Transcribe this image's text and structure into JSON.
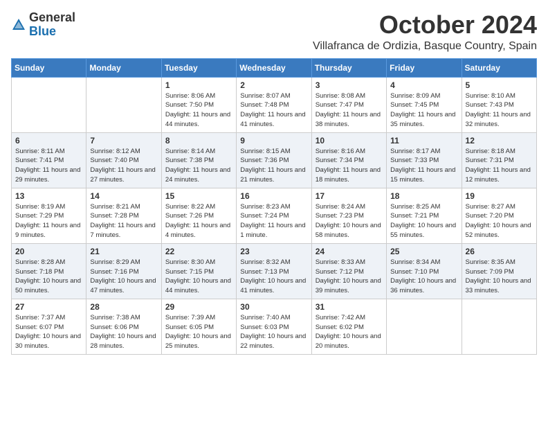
{
  "logo": {
    "general": "General",
    "blue": "Blue"
  },
  "title": "October 2024",
  "location": "Villafranca de Ordizia, Basque Country, Spain",
  "days_of_week": [
    "Sunday",
    "Monday",
    "Tuesday",
    "Wednesday",
    "Thursday",
    "Friday",
    "Saturday"
  ],
  "weeks": [
    [
      {
        "day": "",
        "info": ""
      },
      {
        "day": "",
        "info": ""
      },
      {
        "day": "1",
        "info": "Sunrise: 8:06 AM\nSunset: 7:50 PM\nDaylight: 11 hours and 44 minutes."
      },
      {
        "day": "2",
        "info": "Sunrise: 8:07 AM\nSunset: 7:48 PM\nDaylight: 11 hours and 41 minutes."
      },
      {
        "day": "3",
        "info": "Sunrise: 8:08 AM\nSunset: 7:47 PM\nDaylight: 11 hours and 38 minutes."
      },
      {
        "day": "4",
        "info": "Sunrise: 8:09 AM\nSunset: 7:45 PM\nDaylight: 11 hours and 35 minutes."
      },
      {
        "day": "5",
        "info": "Sunrise: 8:10 AM\nSunset: 7:43 PM\nDaylight: 11 hours and 32 minutes."
      }
    ],
    [
      {
        "day": "6",
        "info": "Sunrise: 8:11 AM\nSunset: 7:41 PM\nDaylight: 11 hours and 29 minutes."
      },
      {
        "day": "7",
        "info": "Sunrise: 8:12 AM\nSunset: 7:40 PM\nDaylight: 11 hours and 27 minutes."
      },
      {
        "day": "8",
        "info": "Sunrise: 8:14 AM\nSunset: 7:38 PM\nDaylight: 11 hours and 24 minutes."
      },
      {
        "day": "9",
        "info": "Sunrise: 8:15 AM\nSunset: 7:36 PM\nDaylight: 11 hours and 21 minutes."
      },
      {
        "day": "10",
        "info": "Sunrise: 8:16 AM\nSunset: 7:34 PM\nDaylight: 11 hours and 18 minutes."
      },
      {
        "day": "11",
        "info": "Sunrise: 8:17 AM\nSunset: 7:33 PM\nDaylight: 11 hours and 15 minutes."
      },
      {
        "day": "12",
        "info": "Sunrise: 8:18 AM\nSunset: 7:31 PM\nDaylight: 11 hours and 12 minutes."
      }
    ],
    [
      {
        "day": "13",
        "info": "Sunrise: 8:19 AM\nSunset: 7:29 PM\nDaylight: 11 hours and 9 minutes."
      },
      {
        "day": "14",
        "info": "Sunrise: 8:21 AM\nSunset: 7:28 PM\nDaylight: 11 hours and 7 minutes."
      },
      {
        "day": "15",
        "info": "Sunrise: 8:22 AM\nSunset: 7:26 PM\nDaylight: 11 hours and 4 minutes."
      },
      {
        "day": "16",
        "info": "Sunrise: 8:23 AM\nSunset: 7:24 PM\nDaylight: 11 hours and 1 minute."
      },
      {
        "day": "17",
        "info": "Sunrise: 8:24 AM\nSunset: 7:23 PM\nDaylight: 10 hours and 58 minutes."
      },
      {
        "day": "18",
        "info": "Sunrise: 8:25 AM\nSunset: 7:21 PM\nDaylight: 10 hours and 55 minutes."
      },
      {
        "day": "19",
        "info": "Sunrise: 8:27 AM\nSunset: 7:20 PM\nDaylight: 10 hours and 52 minutes."
      }
    ],
    [
      {
        "day": "20",
        "info": "Sunrise: 8:28 AM\nSunset: 7:18 PM\nDaylight: 10 hours and 50 minutes."
      },
      {
        "day": "21",
        "info": "Sunrise: 8:29 AM\nSunset: 7:16 PM\nDaylight: 10 hours and 47 minutes."
      },
      {
        "day": "22",
        "info": "Sunrise: 8:30 AM\nSunset: 7:15 PM\nDaylight: 10 hours and 44 minutes."
      },
      {
        "day": "23",
        "info": "Sunrise: 8:32 AM\nSunset: 7:13 PM\nDaylight: 10 hours and 41 minutes."
      },
      {
        "day": "24",
        "info": "Sunrise: 8:33 AM\nSunset: 7:12 PM\nDaylight: 10 hours and 39 minutes."
      },
      {
        "day": "25",
        "info": "Sunrise: 8:34 AM\nSunset: 7:10 PM\nDaylight: 10 hours and 36 minutes."
      },
      {
        "day": "26",
        "info": "Sunrise: 8:35 AM\nSunset: 7:09 PM\nDaylight: 10 hours and 33 minutes."
      }
    ],
    [
      {
        "day": "27",
        "info": "Sunrise: 7:37 AM\nSunset: 6:07 PM\nDaylight: 10 hours and 30 minutes."
      },
      {
        "day": "28",
        "info": "Sunrise: 7:38 AM\nSunset: 6:06 PM\nDaylight: 10 hours and 28 minutes."
      },
      {
        "day": "29",
        "info": "Sunrise: 7:39 AM\nSunset: 6:05 PM\nDaylight: 10 hours and 25 minutes."
      },
      {
        "day": "30",
        "info": "Sunrise: 7:40 AM\nSunset: 6:03 PM\nDaylight: 10 hours and 22 minutes."
      },
      {
        "day": "31",
        "info": "Sunrise: 7:42 AM\nSunset: 6:02 PM\nDaylight: 10 hours and 20 minutes."
      },
      {
        "day": "",
        "info": ""
      },
      {
        "day": "",
        "info": ""
      }
    ]
  ]
}
